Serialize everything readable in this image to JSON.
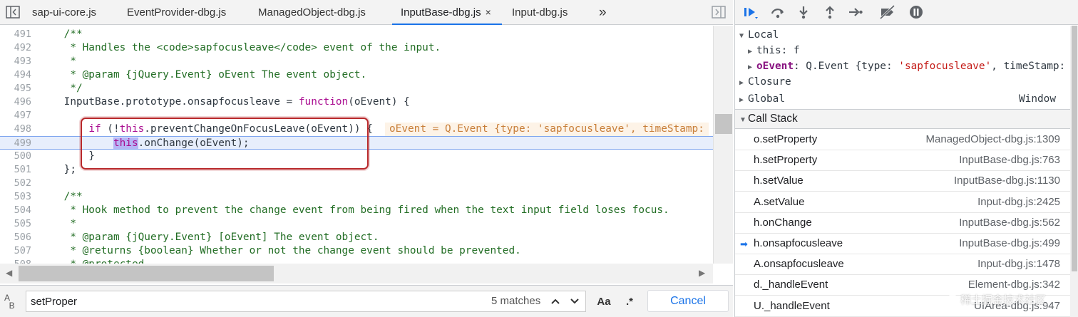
{
  "tabs": [
    {
      "label": "sap-ui-core.js"
    },
    {
      "label": "EventProvider-dbg.js"
    },
    {
      "label": "ManagedObject-dbg.js"
    },
    {
      "label": "InputBase-dbg.js",
      "active": true,
      "close": "×"
    },
    {
      "label": "Input-dbg.js"
    }
  ],
  "tab_overflow": "»",
  "code": {
    "lines": [
      {
        "n": "491",
        "t": "    /**"
      },
      {
        "n": "492",
        "t": "     * Handles the <code>sapfocusleave</code> event of the input."
      },
      {
        "n": "493",
        "t": "     *"
      },
      {
        "n": "494",
        "t": "     * @param {jQuery.Event} oEvent The event object."
      },
      {
        "n": "495",
        "t": "     */"
      },
      {
        "n": "496",
        "pre": "    InputBase.prototype.onsapfocusleave = ",
        "kw": "function",
        "post": "(oEvent) {"
      },
      {
        "n": "497",
        "t": ""
      },
      {
        "n": "498",
        "pre": "        ",
        "kw": "if",
        "mid": " (!",
        "kw2": "this",
        "post": ".preventChangeOnFocusLeave(oEvent)) {"
      },
      {
        "n": "499",
        "pre": "            ",
        "hl": "this",
        "post": ".onChange(oEvent);"
      },
      {
        "n": "500",
        "t": "        }"
      },
      {
        "n": "501",
        "t": "    };"
      },
      {
        "n": "502",
        "t": ""
      },
      {
        "n": "503",
        "t": "    /**"
      },
      {
        "n": "504",
        "t": "     * Hook method to prevent the change event from being fired when the text input field loses focus."
      },
      {
        "n": "505",
        "t": "     *"
      },
      {
        "n": "506",
        "t": "     * @param {jQuery.Event} [oEvent] The event object."
      },
      {
        "n": "507",
        "t": "     * @returns {boolean} Whether or not the change event should be prevented."
      },
      {
        "n": "508",
        "t": "     * @protected"
      }
    ],
    "inline_value": "oEvent = Q.Event {type: 'sapfocusleave', timeStamp:"
  },
  "search": {
    "value": "setProper",
    "matches": "5 matches",
    "case_label": "Aa",
    "regex_label": ".*",
    "cancel": "Cancel"
  },
  "scope": {
    "local": "Local",
    "this_key": "this",
    "this_val": ": f",
    "oevent_key": "oEvent",
    "oevent_pre": ": Q.Event {type: ",
    "oevent_str": "'sapfocusleave'",
    "oevent_post": ", timeStamp:",
    "closure": "Closure",
    "global": "Global",
    "global_val": "Window"
  },
  "call_stack": {
    "title": "Call Stack",
    "frames": [
      {
        "name": "o.setProperty",
        "loc": "ManagedObject-dbg.js:1309"
      },
      {
        "name": "h.setProperty",
        "loc": "InputBase-dbg.js:763"
      },
      {
        "name": "h.setValue",
        "loc": "InputBase-dbg.js:1130"
      },
      {
        "name": "A.setValue",
        "loc": "Input-dbg.js:2425"
      },
      {
        "name": "h.onChange",
        "loc": "InputBase-dbg.js:562"
      },
      {
        "name": "h.onsapfocusleave",
        "loc": "InputBase-dbg.js:499",
        "current": true
      },
      {
        "name": "A.onsapfocusleave",
        "loc": "Input-dbg.js:1478"
      },
      {
        "name": "d._handleEvent",
        "loc": "Element-dbg.js:342"
      },
      {
        "name": "U._handleEvent",
        "loc": "UIArea-dbg.js:947"
      }
    ]
  },
  "watermark": "稀土掘金技术社区",
  "colors": {
    "accent": "#1a73e8",
    "keyword": "#aa0d91",
    "comment": "#236e25",
    "string": "#c41a16",
    "highlight_box": "#b8282b"
  }
}
